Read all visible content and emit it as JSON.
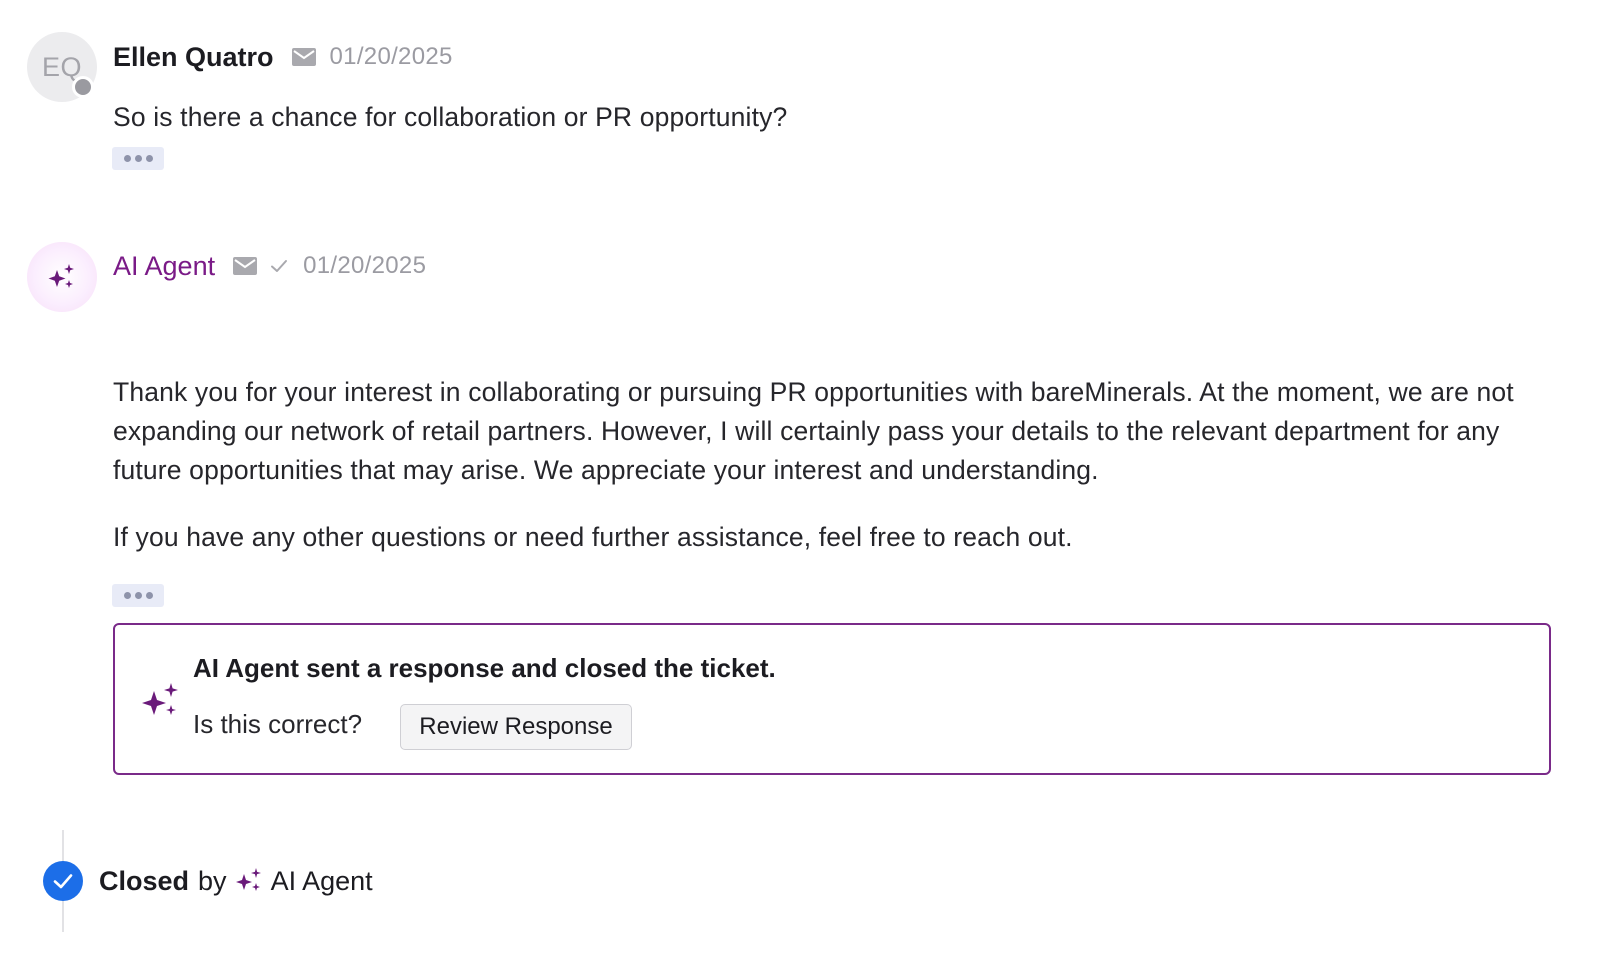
{
  "messages": [
    {
      "author": "Ellen Quatro",
      "initials": "EQ",
      "date": "01/20/2025",
      "paragraphs": [
        "So is there a chance for collaboration or PR opportunity?"
      ]
    },
    {
      "author": "AI Agent",
      "date": "01/20/2025",
      "paragraphs": [
        "Thank you for your interest in collaborating or pursuing PR opportunities with bareMinerals. At the moment, we are not expanding our network of retail partners. However, I will certainly pass your details to the relevant department for any future opportunities that may arise. We appreciate your interest and understanding.",
        "If you have any other questions or need further assistance, feel free to reach out."
      ]
    }
  ],
  "notice": {
    "title": "AI Agent sent a response and closed the ticket.",
    "question": "Is this correct?",
    "button_label": "Review Response"
  },
  "status": {
    "closed_word": "Closed",
    "by_word": "by",
    "actor": "AI Agent"
  },
  "icons": {
    "mail": "mail-icon",
    "sent_check": "check-icon",
    "ai": "sparkle-icon",
    "closed": "check-circle-icon",
    "more": "ellipsis-icon"
  },
  "colors": {
    "ai_purple": "#7a1a87",
    "notice_border": "#7a2a89",
    "closed_badge": "#1c6ee8",
    "timestamp": "#9b9ba2"
  }
}
